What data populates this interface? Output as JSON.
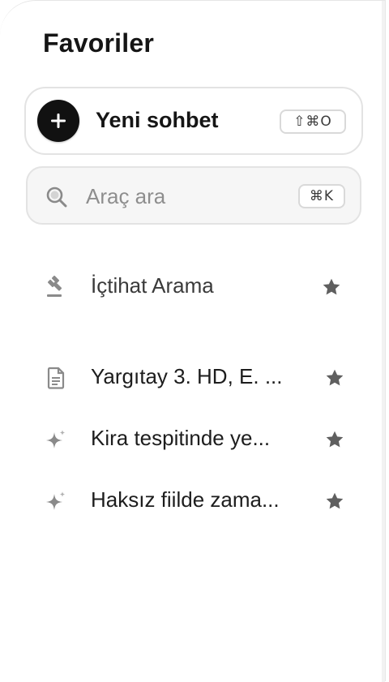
{
  "sidebar": {
    "title": "Favoriler",
    "new_chat": {
      "label": "Yeni sohbet",
      "shortcut": "⇧⌘O",
      "icon": "plus-icon"
    },
    "search": {
      "placeholder": "Araç ara",
      "value": "",
      "shortcut": "⌘K",
      "icon": "search-icon"
    },
    "tools": [
      {
        "label": "İçtihat Arama",
        "icon": "gavel-icon",
        "starred": true
      }
    ],
    "chats": [
      {
        "label": "Yargıtay 3. HD, E. ...",
        "icon": "document-icon",
        "starred": true
      },
      {
        "label": "Kira tespitinde ye...",
        "icon": "sparkle-icon",
        "starred": true
      },
      {
        "label": "Haksız fiilde zama...",
        "icon": "sparkle-icon",
        "starred": true
      }
    ]
  },
  "colors": {
    "star": "#5f5f5f",
    "icon": "#8a8a8a",
    "text": "#1d1d1d"
  }
}
